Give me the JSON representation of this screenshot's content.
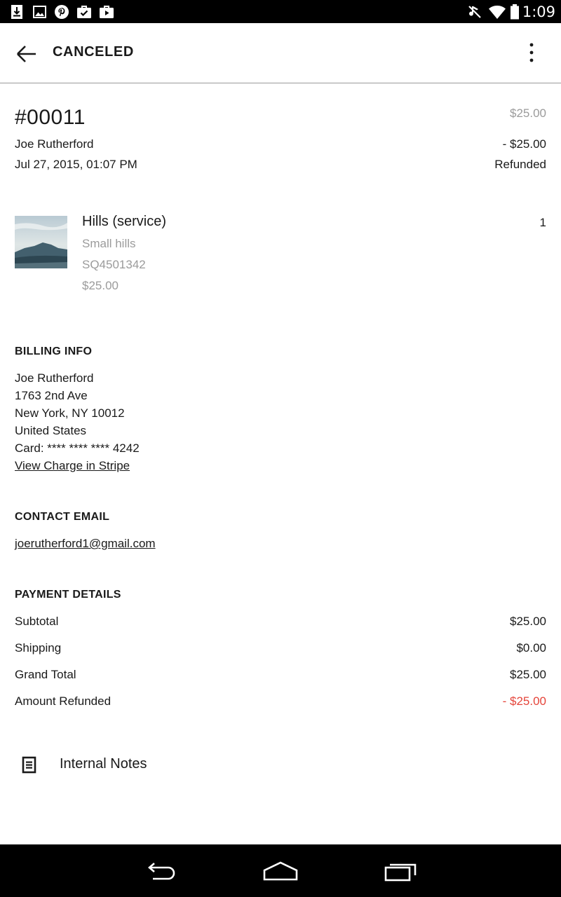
{
  "status_bar": {
    "time": "1:09",
    "icons_left": [
      "download-icon",
      "image-icon",
      "pinterest-icon",
      "briefcase-check-icon",
      "briefcase-play-icon"
    ],
    "icons_right": [
      "mute-icon",
      "wifi-icon",
      "battery-icon"
    ]
  },
  "app_bar": {
    "title": "CANCELED"
  },
  "order": {
    "number": "#00011",
    "customer": "Joe Rutherford",
    "date": "Jul 27, 2015, 01:07 PM",
    "total": "$25.00",
    "refund_amount": "- $25.00",
    "refund_status": "Refunded"
  },
  "item": {
    "name": "Hills (service)",
    "variant": "Small hills",
    "sku": "SQ4501342",
    "price": "$25.00",
    "quantity": "1"
  },
  "billing": {
    "heading": "BILLING INFO",
    "name": "Joe Rutherford",
    "street": "1763 2nd Ave",
    "city": "New York, NY 10012",
    "country": "United States",
    "card": "Card: **** **** **** 4242",
    "stripe_link": "View Charge in Stripe"
  },
  "contact": {
    "heading": "CONTACT EMAIL",
    "email": "joerutherford1@gmail.com"
  },
  "payment": {
    "heading": "PAYMENT DETAILS",
    "rows": [
      {
        "label": "Subtotal",
        "value": "$25.00"
      },
      {
        "label": "Shipping",
        "value": "$0.00"
      },
      {
        "label": "Grand Total",
        "value": "$25.00"
      },
      {
        "label": "Amount Refunded",
        "value": "- $25.00"
      }
    ]
  },
  "notes": {
    "label": "Internal Notes"
  },
  "colors": {
    "refund_red": "#e5443a",
    "muted_grey": "#9b9b9b"
  }
}
